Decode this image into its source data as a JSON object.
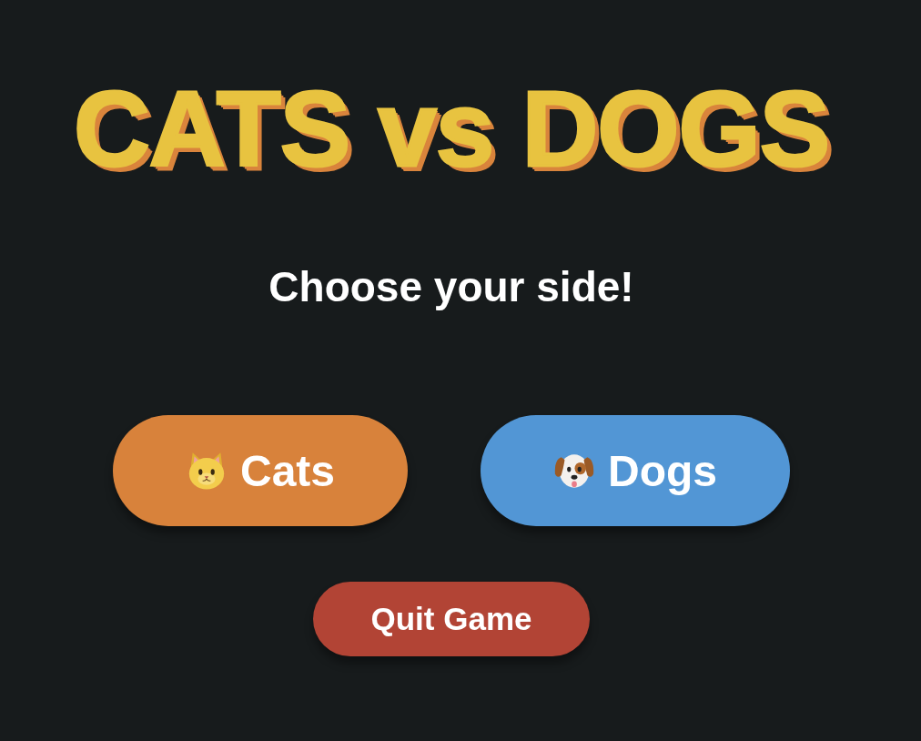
{
  "title": "CATS vs DOGS",
  "subtitle": "Choose your side!",
  "choices": [
    {
      "kind": "cat",
      "label": "Cats",
      "color": "#d8823b"
    },
    {
      "kind": "dog",
      "label": "Dogs",
      "color": "#5296d5"
    }
  ],
  "quit_button": {
    "label": "Quit Game"
  }
}
